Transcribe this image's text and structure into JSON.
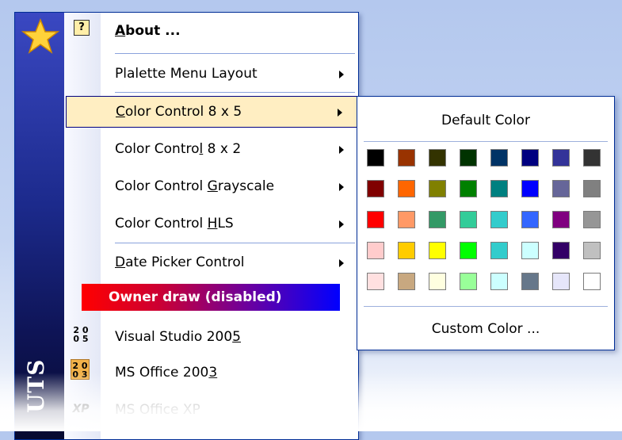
{
  "menu": {
    "sidebar_text": "UTS",
    "items": [
      {
        "pre": "",
        "u": "A",
        "post": "bout ...",
        "bold": true
      },
      {
        "pre": "Plalette Menu Layout",
        "u": "",
        "post": ""
      },
      {
        "pre": "",
        "u": "C",
        "post": "olor Control 8 x 5"
      },
      {
        "pre": "Color Contro",
        "u": "l",
        "post": " 8 x 2"
      },
      {
        "pre": "Color Control ",
        "u": "G",
        "post": "rayscale"
      },
      {
        "pre": "Color Control ",
        "u": "H",
        "post": "LS"
      },
      {
        "pre": "",
        "u": "D",
        "post": "ate Picker Control"
      },
      {
        "pre": "Owner draw (disabled)",
        "u": "",
        "post": ""
      },
      {
        "pre": "Visual Studio 200",
        "u": "5",
        "post": ""
      },
      {
        "pre": "MS Office 200",
        "u": "3",
        "post": ""
      },
      {
        "pre": "MS Office XP",
        "u": "",
        "post": ""
      }
    ],
    "icons": {
      "help": "?",
      "vs2005_top": "2 0",
      "vs2005_bottom": "0 5",
      "office2003_top": "2 0",
      "office2003_bottom": "0 3",
      "xp": "XP"
    }
  },
  "palette": {
    "default_label": "Default Color",
    "custom_label": "Custom Color ...",
    "colors": [
      "#000000",
      "#993300",
      "#333300",
      "#003300",
      "#003366",
      "#000080",
      "#333399",
      "#333333",
      "#800000",
      "#FF6600",
      "#808000",
      "#008000",
      "#008080",
      "#0000FF",
      "#666699",
      "#808080",
      "#FF0000",
      "#FF9966",
      "#339966",
      "#33CC99",
      "#33CCCC",
      "#3366FF",
      "#800080",
      "#969696",
      "#FFCCCC",
      "#FFCC00",
      "#FFFF00",
      "#00FF00",
      "#33CCCC",
      "#CCFFFF",
      "#330066",
      "#C0C0C0",
      "#FFE0E0",
      "#C8A880",
      "#FFFFE0",
      "#99FF99",
      "#CCFFFF",
      "#66778A",
      "#E6E6FA",
      "#FFFFFF"
    ]
  },
  "colors": {
    "menu_border": "#002d96",
    "highlight": "#ffeec2",
    "sidebar": "#1c2a8c"
  }
}
